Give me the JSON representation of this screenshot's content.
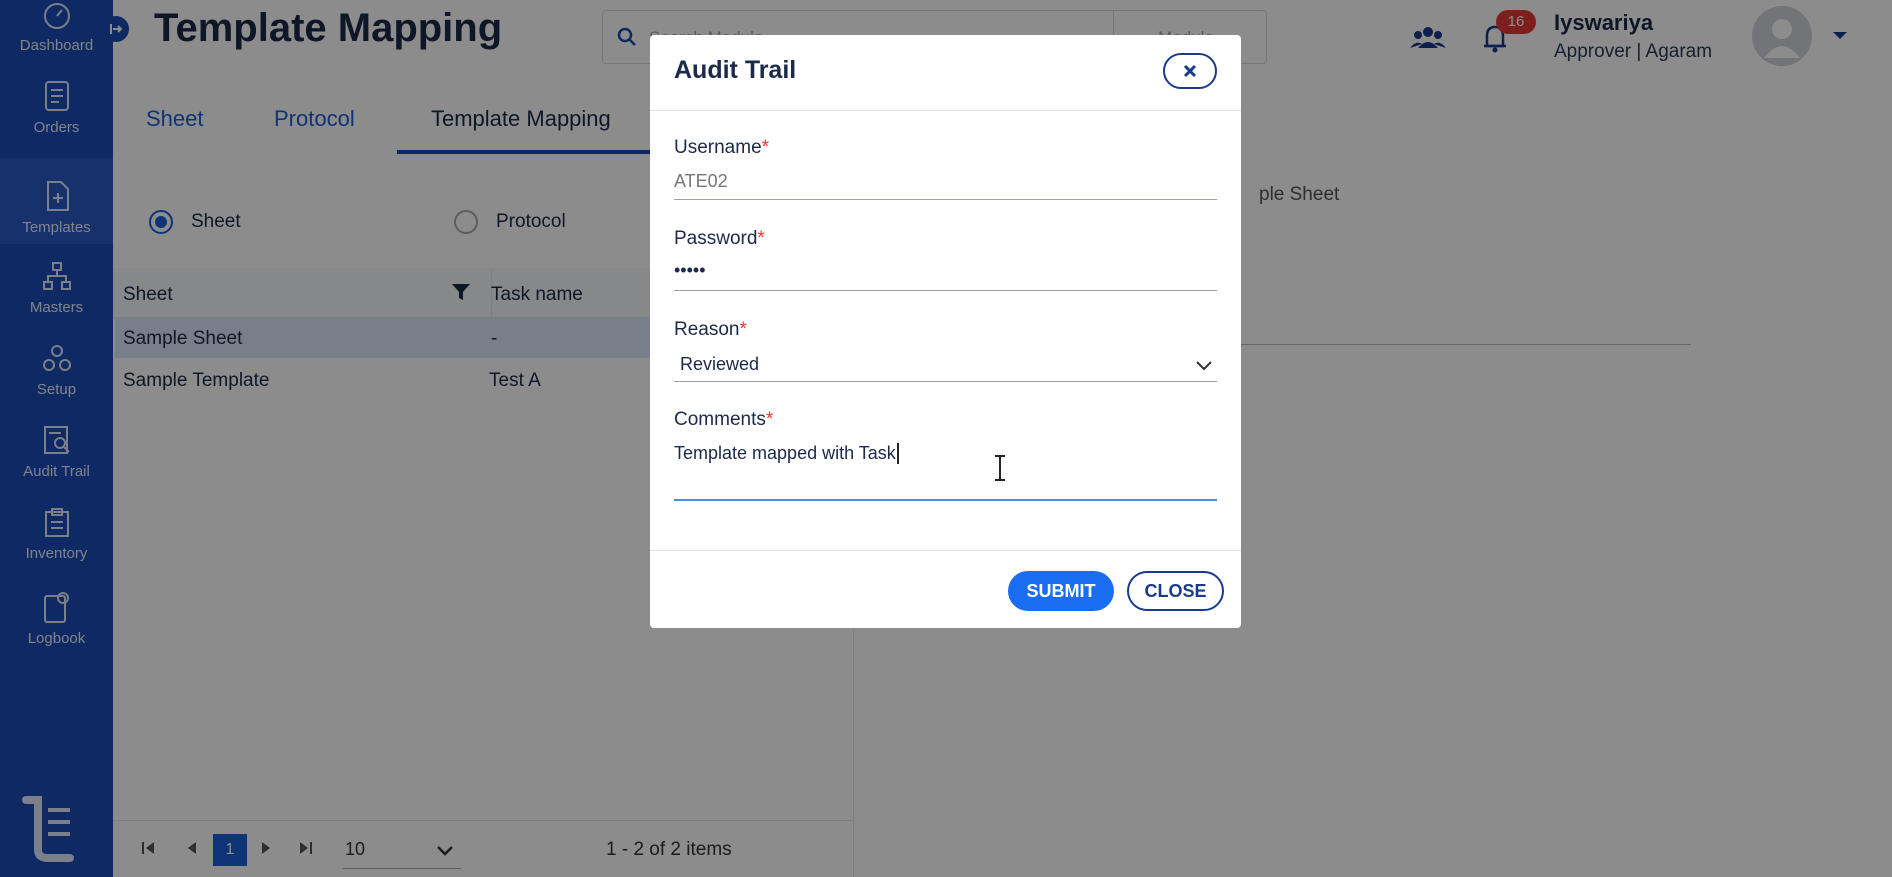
{
  "sidebar": {
    "items": [
      {
        "label": "Dashboard",
        "icon": "dashboard-icon"
      },
      {
        "label": "Orders",
        "icon": "orders-icon"
      },
      {
        "label": "Templates",
        "icon": "templates-icon"
      },
      {
        "label": "Masters",
        "icon": "masters-icon"
      },
      {
        "label": "Setup",
        "icon": "setup-icon"
      },
      {
        "label": "Audit Trail",
        "icon": "audit-trail-icon"
      },
      {
        "label": "Inventory",
        "icon": "inventory-icon"
      },
      {
        "label": "Logbook",
        "icon": "logbook-icon"
      }
    ],
    "color": "#1a4bb5"
  },
  "header": {
    "title": "Template Mapping",
    "search_placeholder": "Search Module",
    "module_label": "Module",
    "notification_count": "16",
    "user_name": "Iyswariya",
    "user_role": "Approver | Agaram"
  },
  "tabs": [
    {
      "label": "Sheet"
    },
    {
      "label": "Protocol"
    },
    {
      "label": "Template Mapping"
    }
  ],
  "filter": {
    "sheet_label": "Sheet",
    "protocol_label": "Protocol"
  },
  "grid": {
    "columns": [
      "Sheet",
      "Task name"
    ],
    "rows": [
      {
        "sheet": "Sample Sheet",
        "task": "-"
      },
      {
        "sheet": "Sample Template",
        "task": "Test A"
      }
    ]
  },
  "pager": {
    "current_page": "1",
    "page_size": "10",
    "summary": "1 - 2 of 2 items"
  },
  "right_panel": {
    "partial_text": "ple Sheet"
  },
  "modal": {
    "title": "Audit Trail",
    "username_label": "Username",
    "username_value": "ATE02",
    "password_label": "Password",
    "password_value": "•••••",
    "reason_label": "Reason",
    "reason_value": "Reviewed",
    "comments_label": "Comments",
    "comments_value": "Template mapped with Task",
    "required_mark": "*",
    "submit_label": "SUBMIT",
    "close_label": "CLOSE"
  }
}
